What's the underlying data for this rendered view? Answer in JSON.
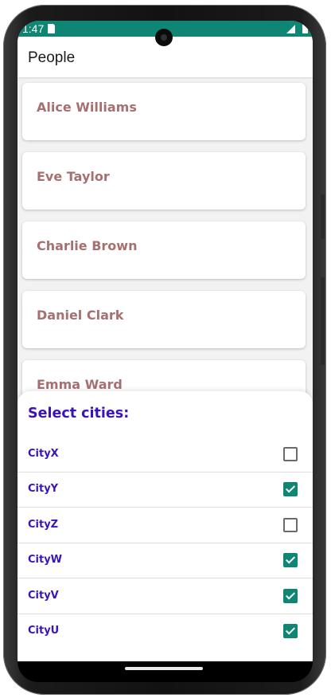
{
  "status_bar": {
    "time": "1:47",
    "icons": [
      "sd-card-icon",
      "signal-icon",
      "battery-icon"
    ]
  },
  "app_bar": {
    "title": "People"
  },
  "people": [
    {
      "name": "Alice Williams"
    },
    {
      "name": "Eve Taylor"
    },
    {
      "name": "Charlie Brown"
    },
    {
      "name": "Daniel Clark"
    },
    {
      "name": "Emma Ward"
    }
  ],
  "city_sheet": {
    "title": "Select cities:",
    "cities": [
      {
        "label": "CityX",
        "checked": false
      },
      {
        "label": "CityY",
        "checked": true
      },
      {
        "label": "CityZ",
        "checked": false
      },
      {
        "label": "CityW",
        "checked": true
      },
      {
        "label": "CityV",
        "checked": true
      },
      {
        "label": "CityU",
        "checked": true
      }
    ]
  },
  "colors": {
    "status_bar": "#0f8573",
    "accent": "#0f8573",
    "sheet_text": "#3b14b8",
    "person_name": "#a77070"
  }
}
